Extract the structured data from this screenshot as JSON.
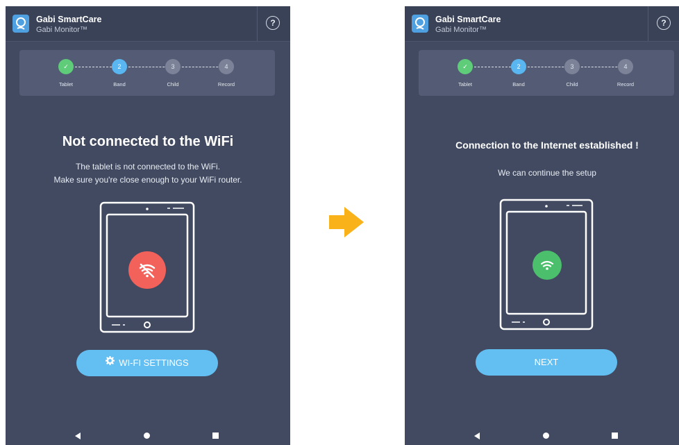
{
  "left_screen": {
    "header": {
      "app_name": "Gabi SmartCare",
      "app_subtitle": "Gabi Monitor™",
      "help_icon": "?"
    },
    "steps": [
      {
        "number": "✓",
        "label": "Tablet",
        "state": "done"
      },
      {
        "number": "2",
        "label": "Band",
        "state": "active"
      },
      {
        "number": "3",
        "label": "Child",
        "state": "pending"
      },
      {
        "number": "4",
        "label": "Record",
        "state": "pending"
      }
    ],
    "title": "Not connected to the WiFi",
    "description_line1": "The tablet is not connected to the WiFi.",
    "description_line2": "Make sure you're close enough to your WiFi router.",
    "status_icon": "wifi-off-icon",
    "status_color": "#f2615a",
    "button_icon": "gear-icon",
    "button_label": "WI-FI SETTINGS"
  },
  "right_screen": {
    "header": {
      "app_name": "Gabi SmartCare",
      "app_subtitle": "Gabi Monitor™",
      "help_icon": "?"
    },
    "steps": [
      {
        "number": "✓",
        "label": "Tablet",
        "state": "done"
      },
      {
        "number": "2",
        "label": "Band",
        "state": "active"
      },
      {
        "number": "3",
        "label": "Child",
        "state": "pending"
      },
      {
        "number": "4",
        "label": "Record",
        "state": "pending"
      }
    ],
    "title": "Connection to the Internet established !",
    "description": "We can continue the setup",
    "status_icon": "wifi-icon",
    "status_color": "#4cbf6c",
    "button_label": "NEXT"
  },
  "transition_arrow_color": "#f9b21a",
  "accent_color": "#63bff2",
  "background_color": "#414a61"
}
